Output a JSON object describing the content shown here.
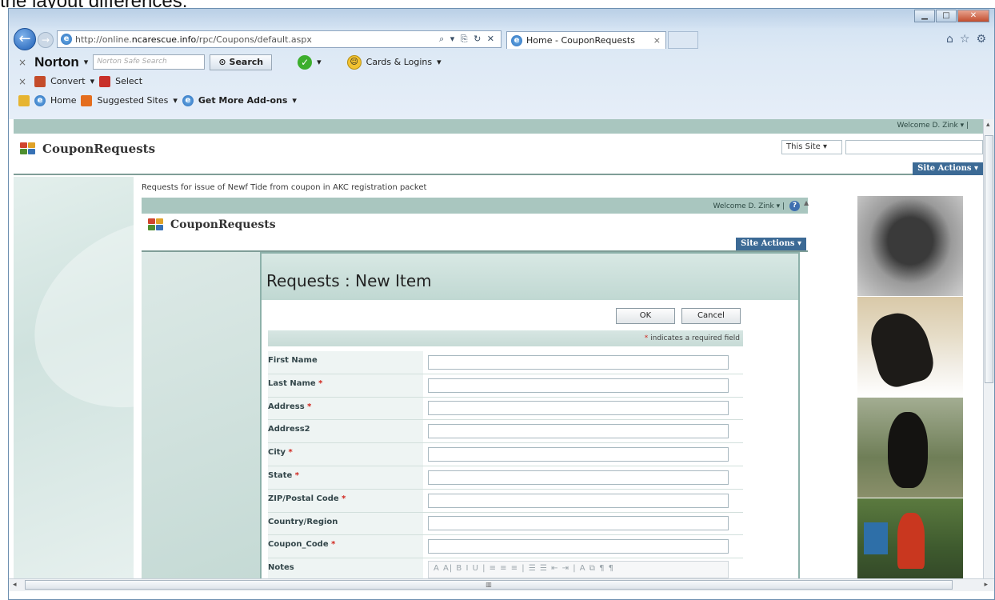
{
  "caption": "the layout differences.",
  "browser": {
    "url_prefix": "http://online.",
    "url_domain": "ncarescue.info",
    "url_path": "/rpc/Coupons/default.aspx",
    "addr_buttons": "⌕ ▾ ⎘ ↻ ✕",
    "tab_title": "Home - CouponRequests",
    "tab_close": "×"
  },
  "norton_bar": {
    "brand": "Norton",
    "search_placeholder": "Norton Safe Search",
    "search_label": "Search",
    "cards_label": "Cards & Logins"
  },
  "convert_bar": {
    "convert_label": "Convert",
    "select_label": "Select"
  },
  "favorites_bar": {
    "home_label": "Home",
    "suggested_label": "Suggested Sites",
    "addons_label": "Get More Add-ons"
  },
  "site": {
    "welcome": "Welcome D. Zink ▾ |",
    "title": "CouponRequests",
    "scope": "This Site ▾",
    "site_actions": "Site Actions ▾",
    "description": "Requests for issue of Newf Tide from coupon in AKC registration packet"
  },
  "inner_site": {
    "welcome": "Welcome D. Zink ▾ |",
    "title": "CouponRequests",
    "site_actions": "Site Actions ▾"
  },
  "form": {
    "title": "Requests : New Item",
    "ok_label": "OK",
    "cancel_label": "Cancel",
    "required_note": "indicates a required field",
    "fields": [
      {
        "label": "First Name",
        "required": false
      },
      {
        "label": "Last Name",
        "required": true
      },
      {
        "label": "Address",
        "required": true
      },
      {
        "label": "Address2",
        "required": false
      },
      {
        "label": "City",
        "required": true
      },
      {
        "label": "State",
        "required": true
      },
      {
        "label": "ZIP/Postal Code",
        "required": true
      },
      {
        "label": "Country/Region",
        "required": false
      },
      {
        "label": "Coupon_Code",
        "required": true
      }
    ],
    "notes_label": "Notes",
    "rte_toolbar": "A A| B I U | ≡ ≡ ≡ | ☰ ☰ ⇤ ⇥ | A ⧉ ¶ ¶"
  },
  "colors": {
    "accent": "#3c6a95",
    "band": "#a9c6bf",
    "required": "#d0251c"
  }
}
